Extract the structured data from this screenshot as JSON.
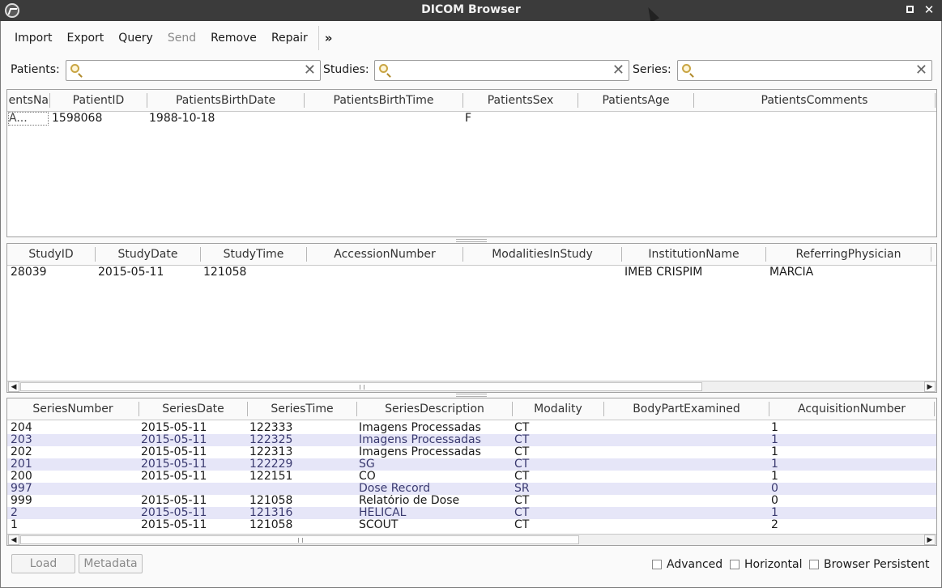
{
  "window": {
    "title": "DICOM Browser"
  },
  "toolbar": {
    "items": [
      {
        "label": "Import",
        "enabled": true
      },
      {
        "label": "Export",
        "enabled": true
      },
      {
        "label": "Query",
        "enabled": true
      },
      {
        "label": "Send",
        "enabled": false
      },
      {
        "label": "Remove",
        "enabled": true
      },
      {
        "label": "Repair",
        "enabled": true
      }
    ],
    "overflow": "»"
  },
  "filters": {
    "patients_label": "Patients:",
    "studies_label": "Studies:",
    "series_label": "Series:",
    "patients_value": "",
    "studies_value": "",
    "series_value": ""
  },
  "patients_table": {
    "columns": [
      "entsNa",
      "PatientID",
      "PatientsBirthDate",
      "PatientsBirthTime",
      "PatientsSex",
      "PatientsAge",
      "PatientsComments"
    ],
    "rows": [
      [
        "A...",
        "1598068",
        "1988-10-18",
        "",
        "F",
        "",
        ""
      ]
    ]
  },
  "studies_table": {
    "columns": [
      "StudyID",
      "StudyDate",
      "StudyTime",
      "AccessionNumber",
      "ModalitiesInStudy",
      "InstitutionName",
      "ReferringPhysician"
    ],
    "rows": [
      [
        "28039",
        "2015-05-11",
        "121058",
        "",
        "",
        "IMEB CRISPIM",
        "MARCIA"
      ]
    ]
  },
  "series_table": {
    "columns": [
      "SeriesNumber",
      "SeriesDate",
      "SeriesTime",
      "SeriesDescription",
      "Modality",
      "BodyPartExamined",
      "AcquisitionNumber"
    ],
    "rows": [
      [
        "204",
        "2015-05-11",
        "122333",
        "Imagens Processadas",
        "CT",
        "",
        "1"
      ],
      [
        "203",
        "2015-05-11",
        "122325",
        "Imagens Processadas",
        "CT",
        "",
        "1"
      ],
      [
        "202",
        "2015-05-11",
        "122313",
        "Imagens Processadas",
        "CT",
        "",
        "1"
      ],
      [
        "201",
        "2015-05-11",
        "122229",
        "SG",
        "CT",
        "",
        "1"
      ],
      [
        "200",
        "2015-05-11",
        "122151",
        "CO",
        "CT",
        "",
        "1"
      ],
      [
        "997",
        "",
        "",
        "Dose Record",
        "SR",
        "",
        "0"
      ],
      [
        "999",
        "2015-05-11",
        "121058",
        "Relatório de Dose",
        "CT",
        "",
        "0"
      ],
      [
        "2",
        "2015-05-11",
        "121316",
        "HELICAL",
        "CT",
        "",
        "1"
      ],
      [
        "1",
        "2015-05-11",
        "121058",
        "SCOUT",
        "CT",
        "",
        "2"
      ]
    ]
  },
  "footer": {
    "load_label": "Load",
    "metadata_label": "Metadata",
    "advanced_label": "Advanced",
    "horizontal_label": "Horizontal",
    "persistent_label": "Browser Persistent",
    "advanced_checked": false,
    "horizontal_checked": false,
    "persistent_checked": false
  }
}
